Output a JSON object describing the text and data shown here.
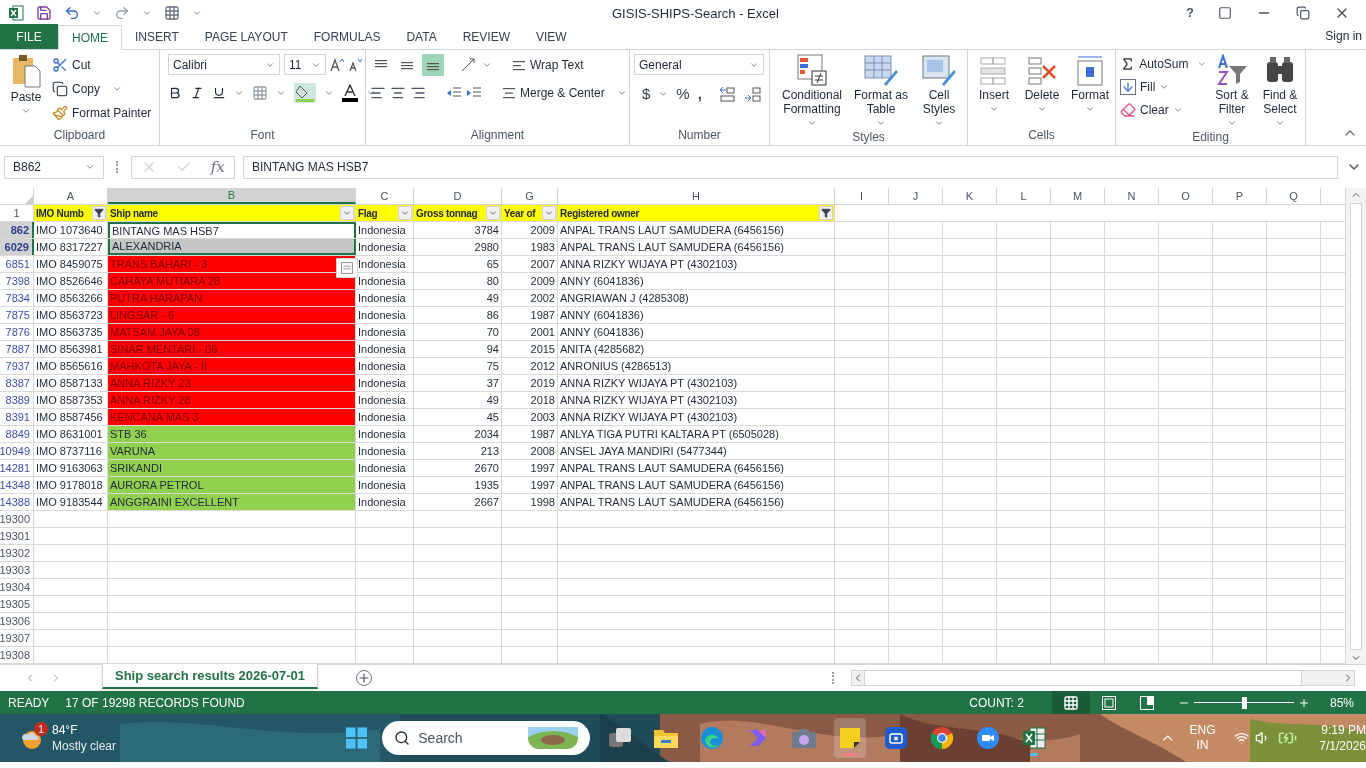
{
  "window": {
    "title": "GISIS-SHIPS-Search - Excel",
    "help": "?",
    "sign_in": "Sign in"
  },
  "ribbon_tabs": [
    {
      "label": "FILE",
      "kind": "file",
      "selected": false
    },
    {
      "label": "HOME",
      "kind": "tab",
      "selected": true
    },
    {
      "label": "INSERT",
      "kind": "tab",
      "selected": false
    },
    {
      "label": "PAGE LAYOUT",
      "kind": "tab",
      "selected": false
    },
    {
      "label": "FORMULAS",
      "kind": "tab",
      "selected": false
    },
    {
      "label": "DATA",
      "kind": "tab",
      "selected": false
    },
    {
      "label": "REVIEW",
      "kind": "tab",
      "selected": false
    },
    {
      "label": "VIEW",
      "kind": "tab",
      "selected": false
    }
  ],
  "ribbon": {
    "clipboard": {
      "label": "Clipboard",
      "paste": "Paste",
      "cut": "Cut",
      "copy": "Copy",
      "format_painter": "Format Painter"
    },
    "font": {
      "label": "Font",
      "font_name": "Calibri",
      "font_size": "11"
    },
    "alignment": {
      "label": "Alignment",
      "wrap_text": "Wrap Text",
      "merge_center": "Merge & Center",
      "vertical": [
        {
          "kind": "top",
          "selected": false
        },
        {
          "kind": "middle",
          "selected": false
        },
        {
          "kind": "bottom",
          "selected": true
        }
      ]
    },
    "number": {
      "label": "Number",
      "format": "General",
      "currency": "$",
      "percent": "%",
      "comma": ","
    },
    "styles": {
      "label": "Styles",
      "buttons": [
        {
          "kind": "conditional",
          "label": "Conditional Formatting"
        },
        {
          "kind": "table",
          "label": "Format as Table"
        },
        {
          "kind": "cellstyles",
          "label": "Cell Styles"
        }
      ]
    },
    "cells": {
      "label": "Cells",
      "buttons": [
        {
          "kind": "insert",
          "label": "Insert"
        },
        {
          "kind": "delete",
          "label": "Delete"
        },
        {
          "kind": "format",
          "label": "Format"
        }
      ]
    },
    "editing": {
      "label": "Editing",
      "autosum": "AutoSum",
      "fill": "Fill",
      "clear": "Clear",
      "buttons": [
        {
          "kind": "sort",
          "label": "Sort & Filter"
        },
        {
          "kind": "find",
          "label": "Find & Select"
        }
      ]
    }
  },
  "formula_bar": {
    "name_box": "B862",
    "function": "fx",
    "value": "BINTANG MAS HSB7"
  },
  "columns": [
    {
      "letter": "A",
      "selected": false
    },
    {
      "letter": "B",
      "selected": true
    },
    {
      "letter": "C",
      "selected": false
    },
    {
      "letter": "D",
      "selected": false
    },
    {
      "letter": "G",
      "selected": false
    },
    {
      "letter": "H",
      "selected": false
    },
    {
      "letter": "I",
      "selected": false
    },
    {
      "letter": "J",
      "selected": false
    },
    {
      "letter": "K",
      "selected": false
    },
    {
      "letter": "L",
      "selected": false
    },
    {
      "letter": "M",
      "selected": false
    },
    {
      "letter": "N",
      "selected": false
    },
    {
      "letter": "O",
      "selected": false
    },
    {
      "letter": "P",
      "selected": false
    },
    {
      "letter": "Q",
      "selected": false
    }
  ],
  "header_row": {
    "row_number": "1",
    "cells": [
      {
        "text": "IMO Numb",
        "filtered": true
      },
      {
        "text": "Ship name",
        "filtered": false
      },
      {
        "text": "Flag",
        "filtered": false
      },
      {
        "text": "Gross tonnag",
        "filtered": false
      },
      {
        "text": "Year of",
        "filtered": false
      },
      {
        "text": "Registered owner",
        "filtered": true
      }
    ]
  },
  "rows": [
    {
      "row_number": "862",
      "selected": true,
      "cells": [
        "IMO 1073640",
        "BINTANG MAS HSB7",
        "Indonesia",
        "3784",
        "2009",
        "ANPAL TRANS LAUT SAMUDERA (6456156)"
      ]
    },
    {
      "row_number": "6029",
      "selected": true,
      "cells": [
        "IMO 8317227",
        "ALEXANDRIA",
        "Indonesia",
        "2980",
        "1983",
        "ANPAL TRANS LAUT SAMUDERA (6456156)"
      ]
    },
    {
      "row_number": "6851",
      "selected": false,
      "color": "#ff0000",
      "cells": [
        "IMO 8459075",
        "TRANS BAHARI - 3",
        "Indonesia",
        "65",
        "2007",
        "ANNA RIZKY WIJAYA PT (4302103)"
      ]
    },
    {
      "row_number": "7398",
      "selected": false,
      "color": "#ff0000",
      "cells": [
        "IMO 8526646",
        "CAHAYA MUTIARA 28",
        "Indonesia",
        "80",
        "2009",
        "ANNY (6041836)"
      ]
    },
    {
      "row_number": "7834",
      "selected": false,
      "color": "#ff0000",
      "cells": [
        "IMO 8563266",
        "PUTRA HARAPAN",
        "Indonesia",
        "49",
        "2002",
        "ANGRIAWAN J (4285308)"
      ]
    },
    {
      "row_number": "7875",
      "selected": false,
      "color": "#ff0000",
      "cells": [
        "IMO 8563723",
        "LINGSAR - 6",
        "Indonesia",
        "86",
        "1987",
        "ANNY (6041836)"
      ]
    },
    {
      "row_number": "7876",
      "selected": false,
      "color": "#ff0000",
      "cells": [
        "IMO 8563735",
        "MATSAM JAYA 08",
        "Indonesia",
        "70",
        "2001",
        "ANNY (6041836)"
      ]
    },
    {
      "row_number": "7887",
      "selected": false,
      "color": "#ff0000",
      "cells": [
        "IMO 8563981",
        "SINAR MENTARI - 06",
        "Indonesia",
        "94",
        "2015",
        "ANITA (4285682)"
      ]
    },
    {
      "row_number": "7937",
      "selected": false,
      "color": "#ff0000",
      "cells": [
        "IMO 8565616",
        "MAHKOTA JAYA - II",
        "Indonesia",
        "75",
        "2012",
        "ANRONIUS (4286513)"
      ]
    },
    {
      "row_number": "8387",
      "selected": false,
      "color": "#ff0000",
      "cells": [
        "IMO 8587133",
        "ANNA RIZKY 23",
        "Indonesia",
        "37",
        "2019",
        "ANNA RIZKY WIJAYA PT (4302103)"
      ]
    },
    {
      "row_number": "8389",
      "selected": false,
      "color": "#ff0000",
      "cells": [
        "IMO 8587353",
        "ANNA RIZKY 28",
        "Indonesia",
        "49",
        "2018",
        "ANNA RIZKY WIJAYA PT (4302103)"
      ]
    },
    {
      "row_number": "8391",
      "selected": false,
      "color": "#ff0000",
      "cells": [
        "IMO 8587456",
        "KENCANA MAS 3",
        "Indonesia",
        "45",
        "2003",
        "ANNA RIZKY WIJAYA PT (4302103)"
      ]
    },
    {
      "row_number": "8849",
      "selected": false,
      "color": "#92d050",
      "cells": [
        "IMO 8631001",
        "STB 36",
        "Indonesia",
        "2034",
        "1987",
        "ANLYA TIGA PUTRI KALTARA PT (6505028)"
      ]
    },
    {
      "row_number": "10949",
      "selected": false,
      "color": "#92d050",
      "cells": [
        "IMO 8737116",
        "VARUNA",
        "Indonesia",
        "213",
        "2008",
        "ANSEL JAYA MANDIRI (5477344)"
      ]
    },
    {
      "row_number": "14281",
      "selected": false,
      "color": "#92d050",
      "cells": [
        "IMO 9163063",
        "SRIKANDI",
        "Indonesia",
        "2670",
        "1997",
        "ANPAL TRANS LAUT SAMUDERA (6456156)"
      ]
    },
    {
      "row_number": "14348",
      "selected": false,
      "color": "#92d050",
      "cells": [
        "IMO 9178018",
        "AURORA PETROL",
        "Indonesia",
        "1935",
        "1997",
        "ANPAL TRANS LAUT SAMUDERA (6456156)"
      ]
    },
    {
      "row_number": "14388",
      "selected": false,
      "color": "#92d050",
      "cells": [
        "IMO 9183544",
        "ANGGRAINI EXCELLENT",
        "Indonesia",
        "2667",
        "1998",
        "ANPAL TRANS LAUT SAMUDERA (6456156)"
      ]
    }
  ],
  "empty_rows": [
    "19300",
    "19301",
    "19302",
    "19303",
    "19304",
    "19305",
    "19306",
    "19307",
    "19308"
  ],
  "sheet_tabs": [
    {
      "label": "Ship search results 2026-07-01",
      "selected": true
    }
  ],
  "status_bar": {
    "mode": "READY",
    "message": "17 OF 19298 RECORDS FOUND",
    "count": "COUNT: 2",
    "views": [
      {
        "kind": "normal",
        "selected": true
      },
      {
        "kind": "layout",
        "selected": false
      },
      {
        "kind": "break",
        "selected": false
      }
    ],
    "zoom": {
      "level": 0.5,
      "label": "85%"
    }
  },
  "taskbar": {
    "weather": {
      "badge": "1",
      "temperature": "84°F",
      "condition": "Mostly clear"
    },
    "search": {
      "placeholder": "Search"
    },
    "apps": [
      {
        "kind": "taskview",
        "running": false,
        "selected": false
      },
      {
        "kind": "explorer",
        "running": false,
        "selected": false
      },
      {
        "kind": "edge",
        "running": false,
        "selected": false
      },
      {
        "kind": "copilot",
        "running": false,
        "selected": false
      },
      {
        "kind": "camera",
        "running": false,
        "selected": false
      },
      {
        "kind": "notes",
        "running": true,
        "selected": true
      },
      {
        "kind": "capture",
        "running": false,
        "selected": false
      },
      {
        "kind": "chrome",
        "running": false,
        "selected": false
      },
      {
        "kind": "zoom",
        "running": false,
        "selected": false
      },
      {
        "kind": "excel",
        "running": true,
        "selected": false
      }
    ],
    "tray": {
      "language": "ENG",
      "region": "IN",
      "time": "9:19 PM",
      "date": "7/1/2026"
    }
  }
}
